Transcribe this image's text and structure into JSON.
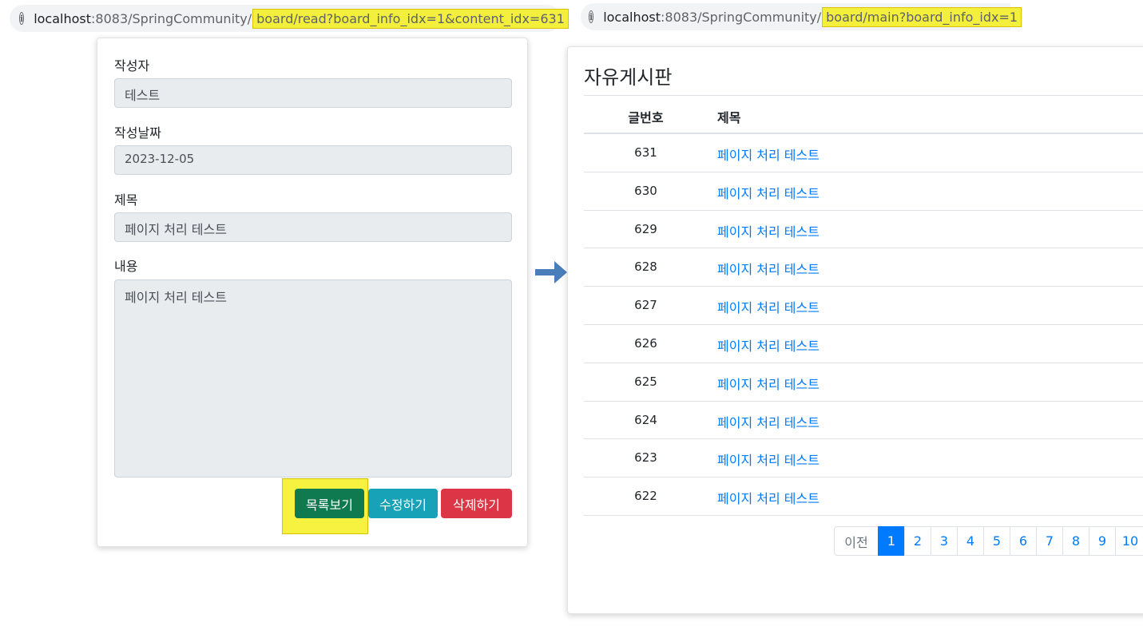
{
  "left_url": {
    "host": "localhost",
    "path": ":8083/SpringCommunity/",
    "highlighted": "board/read?board_info_idx=1&content_idx=631"
  },
  "right_url": {
    "host": "localhost",
    "path": ":8083/SpringCommunity/",
    "highlighted": "board/main?board_info_idx=1"
  },
  "read_form": {
    "writer_label": "작성자",
    "writer_value": "테스트",
    "date_label": "작성날짜",
    "date_value": "2023-12-05",
    "subject_label": "제목",
    "subject_value": "페이지 처리 테스트",
    "content_label": "내용",
    "content_value": "페이지 처리 테스트",
    "buttons": {
      "list": "목록보기",
      "edit": "수정하기",
      "delete": "삭제하기"
    },
    "colors": {
      "list": "#0f7a4f",
      "edit": "#17a2b8",
      "delete": "#dc3545",
      "highlight": "#f7f13f"
    }
  },
  "arrow_icon": "right-arrow-icon",
  "board": {
    "title": "자유게시판",
    "col_num": "글번호",
    "col_title": "제목",
    "rows": [
      {
        "num": "631",
        "title": "페이지 처리 테스트"
      },
      {
        "num": "630",
        "title": "페이지 처리 테스트"
      },
      {
        "num": "629",
        "title": "페이지 처리 테스트"
      },
      {
        "num": "628",
        "title": "페이지 처리 테스트"
      },
      {
        "num": "627",
        "title": "페이지 처리 테스트"
      },
      {
        "num": "626",
        "title": "페이지 처리 테스트"
      },
      {
        "num": "625",
        "title": "페이지 처리 테스트"
      },
      {
        "num": "624",
        "title": "페이지 처리 테스트"
      },
      {
        "num": "623",
        "title": "페이지 처리 테스트"
      },
      {
        "num": "622",
        "title": "페이지 처리 테스트"
      }
    ],
    "pagination": {
      "prev": "이전",
      "pages": [
        "1",
        "2",
        "3",
        "4",
        "5",
        "6",
        "7",
        "8",
        "9",
        "10"
      ],
      "active": "1"
    }
  }
}
